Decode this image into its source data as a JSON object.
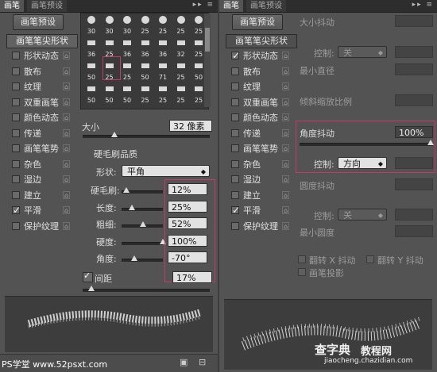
{
  "left": {
    "tabs": [
      "画笔",
      "画笔预设"
    ],
    "preset_button": "画笔预设",
    "tip_shape_button": "画笔笔尖形状",
    "categories": [
      {
        "label": "形状动态",
        "checked": false
      },
      {
        "label": "散布",
        "checked": false
      },
      {
        "label": "纹理",
        "checked": false
      },
      {
        "label": "双重画笔",
        "checked": false
      },
      {
        "label": "颜色动态",
        "checked": false
      },
      {
        "label": "传递",
        "checked": false
      },
      {
        "label": "画笔笔势",
        "checked": false
      },
      {
        "label": "杂色",
        "checked": false
      },
      {
        "label": "湿边",
        "checked": false
      },
      {
        "label": "建立",
        "checked": false
      },
      {
        "label": "平滑",
        "checked": true
      },
      {
        "label": "保护纹理",
        "checked": false
      }
    ],
    "brush_tips": [
      "30",
      "30",
      "30",
      "25",
      "25",
      "25",
      "25",
      "36",
      "25",
      "36",
      "36",
      "36",
      "32",
      "25",
      "50",
      "25",
      "25",
      "50",
      "71",
      "25",
      "50",
      "50",
      "50",
      "50",
      "25",
      "25",
      "25",
      "25"
    ],
    "size_label": "大小",
    "size_value": "32 像素",
    "bristle_title": "硬毛刷品质",
    "shape_label": "形状:",
    "shape_value": "平角",
    "params": [
      {
        "label": "硬毛刷:",
        "value": "12%",
        "level": 0.12
      },
      {
        "label": "长度:",
        "value": "25%",
        "level": 0.25
      },
      {
        "label": "粗细:",
        "value": "52%",
        "level": 0.52
      },
      {
        "label": "硬度:",
        "value": "100%",
        "level": 1.0
      },
      {
        "label": "角度:",
        "value": "-70°",
        "level": 0.31
      }
    ],
    "spacing_label": "间距",
    "spacing_value": "17%",
    "watermark": "PS学堂 www.52psxt.com"
  },
  "right": {
    "tabs": [
      "画笔",
      "画笔预设"
    ],
    "preset_button": "画笔预设",
    "tip_shape_button": "画笔笔尖形状",
    "categories": [
      {
        "label": "形状动态",
        "checked": true
      },
      {
        "label": "散布",
        "checked": false
      },
      {
        "label": "纹理",
        "checked": false
      },
      {
        "label": "双重画笔",
        "checked": false
      },
      {
        "label": "颜色动态",
        "checked": false
      },
      {
        "label": "传递",
        "checked": false
      },
      {
        "label": "画笔笔势",
        "checked": false
      },
      {
        "label": "杂色",
        "checked": false
      },
      {
        "label": "湿边",
        "checked": false
      },
      {
        "label": "建立",
        "checked": false
      },
      {
        "label": "平滑",
        "checked": true
      },
      {
        "label": "保护纹理",
        "checked": false
      }
    ],
    "size_jitter_label": "大小抖动",
    "control_label": "控制:",
    "control_off": "关",
    "min_diameter_label": "最小直径",
    "tilt_scale_label": "倾斜缩放比例",
    "angle_jitter_label": "角度抖动",
    "angle_jitter_value": "100%",
    "angle_control_label": "控制:",
    "angle_control_value": "方向",
    "roundness_jitter_label": "圆度抖动",
    "roundness_control_label": "控制:",
    "roundness_control_value": "关",
    "min_roundness_label": "最小圆度",
    "flip_x_label": "翻转 X 抖动",
    "flip_y_label": "翻转 Y 抖动",
    "brush_projection_label": "画笔投影",
    "watermark_main": "查字典",
    "watermark_sub": "教程网",
    "watermark_url": "jiaocheng.chazidian.com"
  }
}
